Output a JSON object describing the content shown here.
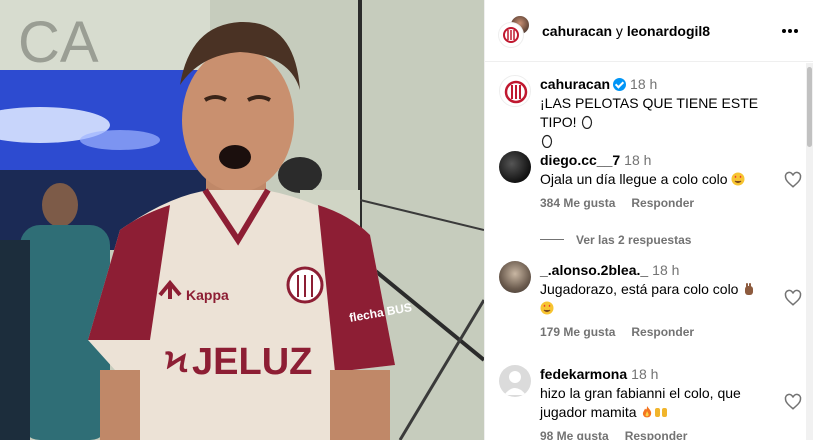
{
  "photo": {
    "sign_text": "CA",
    "sponsor_text": "JELUZ",
    "sponsor_initial": "Ϟ",
    "brand_text": "Kappa",
    "sleeve_text": "flecha BUS"
  },
  "header": {
    "account_a": "cahuracan",
    "joiner": " y ",
    "account_b": "leonardogil8"
  },
  "caption": {
    "username": "cahuracan",
    "time": "18 h",
    "text": "¡LAS PELOTAS QUE TIENE ESTE TIPO! "
  },
  "comments": [
    {
      "username": "diego.cc__7",
      "time": "18 h",
      "text": "Ojala un día llegue a colo colo ",
      "likes": "384 Me gusta",
      "reply": "Responder",
      "view_replies": "Ver las 2 respuestas"
    },
    {
      "username": "_.alonso.2blea._",
      "time": "18 h",
      "text": "Jugadorazo, está para colo colo ",
      "likes": "179 Me gusta",
      "reply": "Responder"
    },
    {
      "username": "fedekarmona",
      "time": "18 h",
      "text": "hizo la gran fabianni el colo, que jugador mamita ",
      "likes": "98 Me gusta",
      "reply": "Responder"
    }
  ],
  "colors": {
    "verified": "#0095f6",
    "muted": "#737373",
    "jersey_maroon": "#8d1e34",
    "jersey_cream": "#eee4d8"
  },
  "icons": [
    "more-options-icon",
    "verified-badge-icon",
    "heart-icon",
    "egg-emoji-icon",
    "star-struck-emoji-icon",
    "hand-emoji-icon",
    "fire-emoji-icon",
    "raised-hands-emoji-icon"
  ]
}
